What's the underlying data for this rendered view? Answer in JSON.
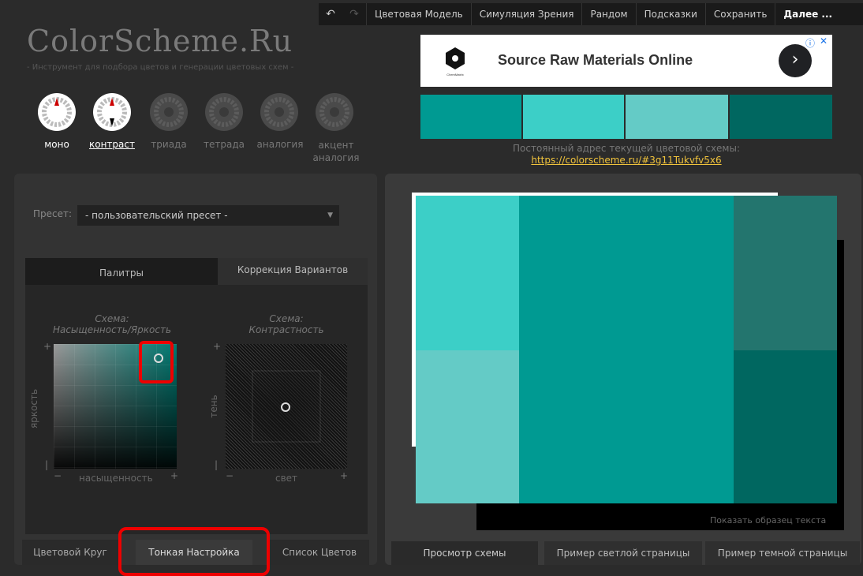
{
  "topbar": {
    "items": [
      "Цветовая Модель",
      "Симуляция Зрения",
      "Рандом",
      "Подсказки",
      "Сохранить",
      "Далее ..."
    ]
  },
  "logo": "ColorScheme.Ru",
  "tagline": "- Инструмент для подбора цветов и генерации цветовых схем -",
  "ad": {
    "title": "Source Raw Materials Online",
    "logo_text": "ChemMatrix"
  },
  "swatches": [
    "#009a92",
    "#3ccfc7",
    "#64cbc6",
    "#006760"
  ],
  "address": {
    "label": "Постоянный адрес текущей цветовой схемы:",
    "link": "https://colorscheme.ru/#3g11Tukvfv5x6"
  },
  "schemes": [
    {
      "label": "моно",
      "active": true
    },
    {
      "label": "контраст",
      "active": true
    },
    {
      "label": "триада",
      "active": false
    },
    {
      "label": "тетрада",
      "active": false
    },
    {
      "label": "аналогия",
      "active": false
    },
    {
      "label": "акцент\nаналогия",
      "active": false
    }
  ],
  "preset": {
    "label": "Пресет:",
    "value": "- пользовательский пресет -"
  },
  "inner_tabs": {
    "palettes": "Палитры",
    "correction": "Коррекция Вариантов"
  },
  "schema_sat": {
    "title_line1": "Схема:",
    "title_line2": "Насыщенность/Яркость",
    "y_label": "яркость",
    "x_label": "насыщенность"
  },
  "schema_con": {
    "title_line1": "Схема:",
    "title_line2": "Контрастность",
    "y_label": "тень",
    "x_label": "свет"
  },
  "signs": {
    "plus": "+",
    "minus": "−",
    "bar": "|"
  },
  "left_tabs": [
    "Цветовой Круг",
    "Тонкая Настройка",
    "Список Цветов"
  ],
  "right_tabs": [
    "Просмотр схемы",
    "Пример светлой страницы",
    "Пример темной страницы"
  ],
  "show_text": "Показать образец текста",
  "preview_colors": {
    "a1": "#3ccfc7",
    "a2": "#64cbc6",
    "main": "#009a92",
    "b1": "#23756e",
    "b2": "#006760"
  }
}
